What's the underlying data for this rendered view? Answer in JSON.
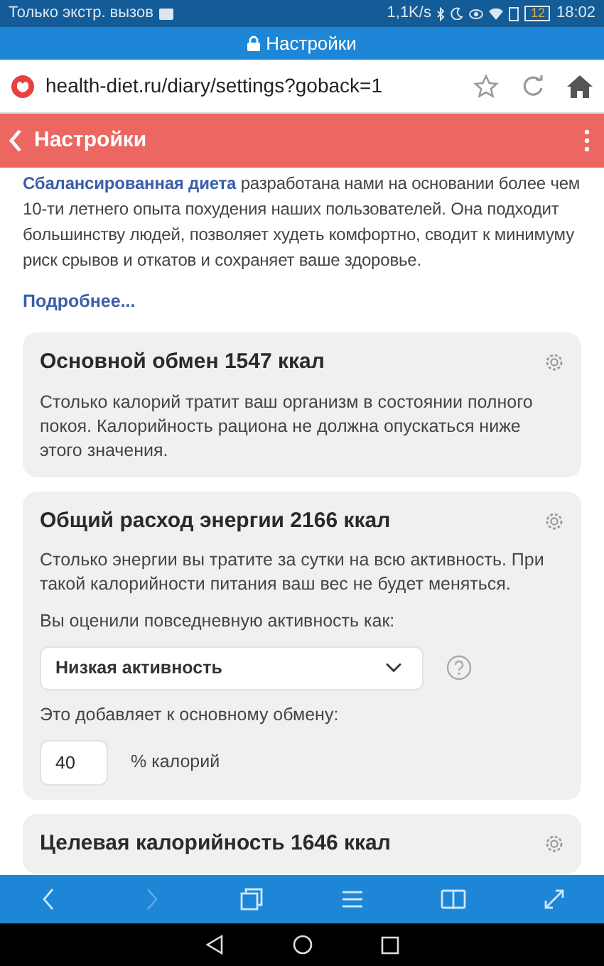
{
  "status_bar": {
    "carrier": "Только экстр. вызов",
    "speed": "1,1K/s",
    "battery": "12",
    "time": "18:02"
  },
  "browser": {
    "title": "Настройки",
    "url": "health-diet.ru/diary/settings?goback=1"
  },
  "app_header": {
    "title": "Настройки"
  },
  "intro": {
    "text": "**Сбалансированная диета** разработана нами на основании более чем 10-ти летнего опыта похудения наших пользователей. Она подходит большинству людей, позволяет худеть комфортно, сводит к минимуму риск срывов и откатов и сохраняет ваше здоровье.",
    "more_link": "Подробнее..."
  },
  "cards": [
    {
      "title": "Основной обмен 1547 ккал",
      "description": "Столько калорий тратит ваш организм в состоянии полного покоя. Калорийность рациона не должна опускаться ниже этого значения."
    },
    {
      "title": "Общий расход энергии 2166 ккал",
      "description": "Столько энергии вы тратите за сутки на всю активность. При такой калорийности питания ваш вес не будет меняться.",
      "activity_label": "Вы оценили повседневную активность как:",
      "activity_value": "Низкая активность",
      "added_label": "Это добавляет к основному обмену:",
      "percent_value": "40",
      "percent_unit": "% калорий"
    },
    {
      "title": "Целевая калорийность 1646 ккал"
    }
  ],
  "toolbar": [
    {
      "kind": "back",
      "disabled": false
    },
    {
      "kind": "forward",
      "disabled": true
    },
    {
      "kind": "tabs",
      "disabled": false
    },
    {
      "kind": "menu",
      "disabled": false
    },
    {
      "kind": "reader",
      "disabled": false
    },
    {
      "kind": "fullscreen",
      "disabled": false
    }
  ]
}
